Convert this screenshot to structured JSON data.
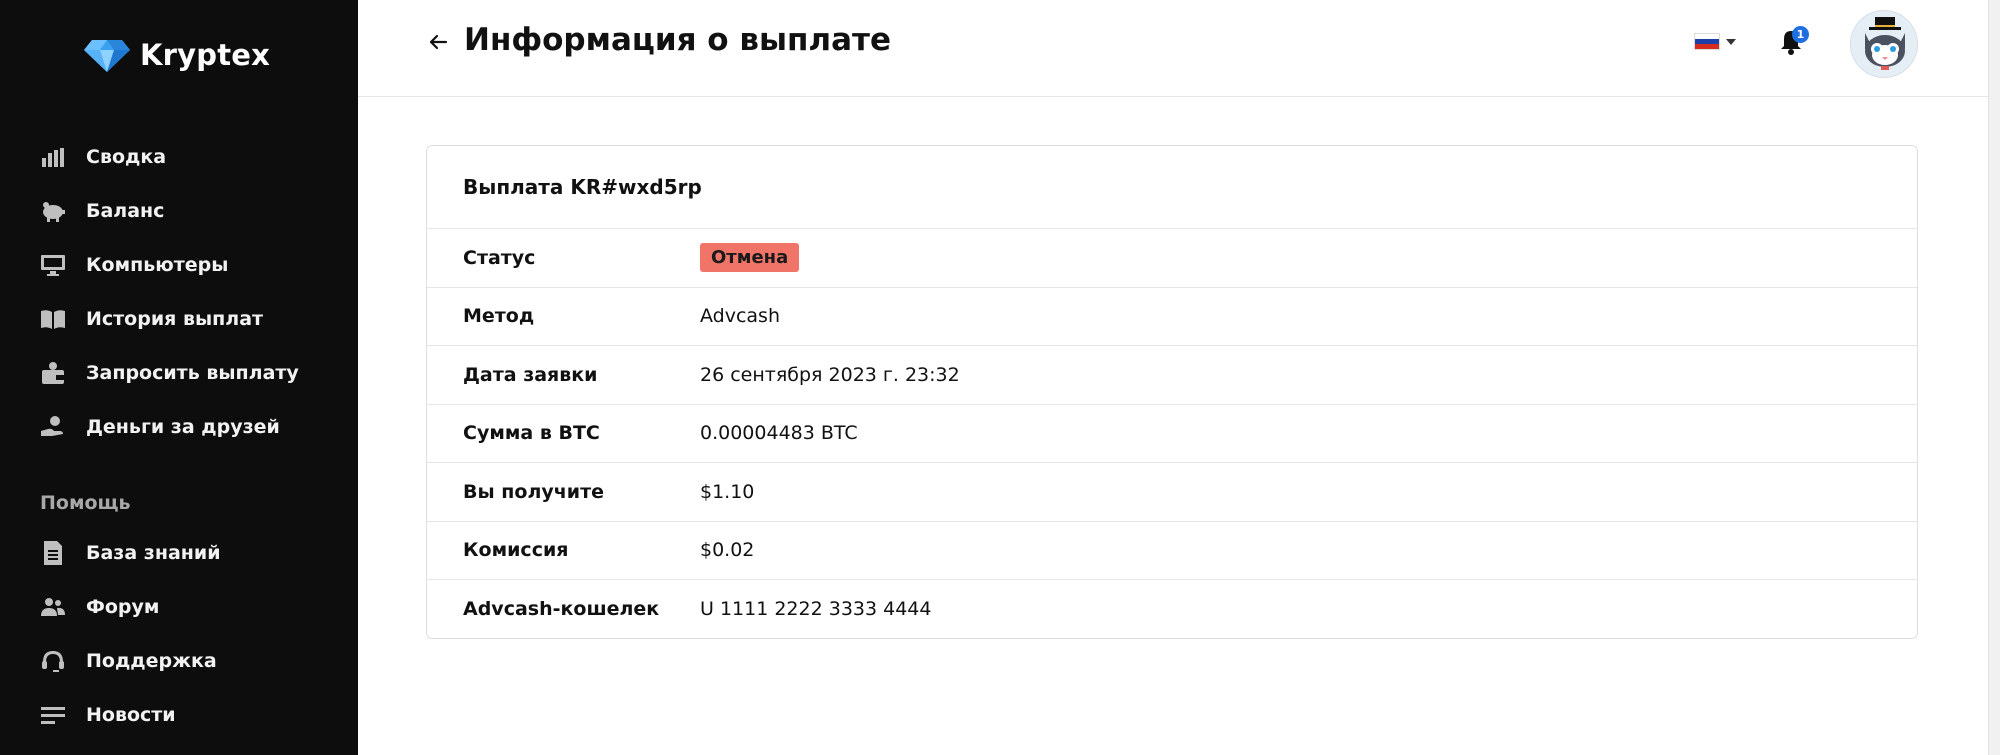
{
  "brand": {
    "name": "Kryptex"
  },
  "sidebar": {
    "items": [
      {
        "label": "Сводка",
        "icon": "chart-bars-icon"
      },
      {
        "label": "Баланс",
        "icon": "piggy-bank-icon"
      },
      {
        "label": "Компьютеры",
        "icon": "monitor-icon"
      },
      {
        "label": "История выплат",
        "icon": "book-icon"
      },
      {
        "label": "Запросить выплату",
        "icon": "wallet-icon"
      },
      {
        "label": "Деньги за друзей",
        "icon": "hand-coin-icon"
      }
    ],
    "help_section": "Помощь",
    "help_items": [
      {
        "label": "База знаний",
        "icon": "document-icon"
      },
      {
        "label": "Форум",
        "icon": "users-icon"
      },
      {
        "label": "Поддержка",
        "icon": "headset-icon"
      },
      {
        "label": "Новости",
        "icon": "lines-icon"
      }
    ]
  },
  "header": {
    "title": "Информация о выплате",
    "notifications_count": "1",
    "language_flag": "ru-flag-icon"
  },
  "payout": {
    "title": "Выплата KR#wxd5rp",
    "rows": [
      {
        "label": "Статус",
        "value": "Отмена",
        "type": "badge"
      },
      {
        "label": "Метод",
        "value": "Advcash"
      },
      {
        "label": "Дата заявки",
        "value": "26 сентября 2023 г. 23:32"
      },
      {
        "label": "Сумма в BTC",
        "value": "0.00004483 BTC"
      },
      {
        "label": "Вы получите",
        "value": "$1.10"
      },
      {
        "label": "Комиссия",
        "value": "$0.02"
      },
      {
        "label": "Advcash-кошелек",
        "value": "U 1111 2222 3333 4444"
      }
    ]
  },
  "colors": {
    "sidebar_bg": "#0d0d0d",
    "status_cancel": "#f07468",
    "badge_blue": "#1e6fe0"
  }
}
